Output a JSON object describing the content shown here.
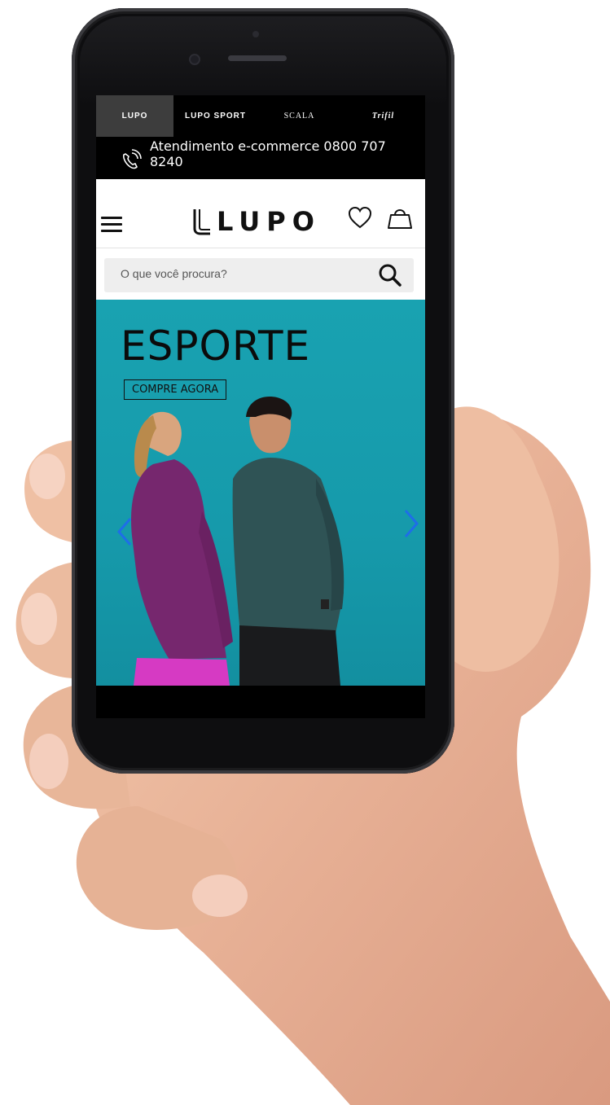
{
  "brand_tabs": [
    {
      "label": "LUPO",
      "active": true
    },
    {
      "label": "LUPO SPORT",
      "active": false
    },
    {
      "label": "SCALA",
      "active": false
    },
    {
      "label": "Trifil",
      "active": false
    }
  ],
  "support": {
    "text": "Atendimento e-commerce 0800 707 8240"
  },
  "header": {
    "logo": "LUPO",
    "icons": [
      "menu-icon",
      "heart-icon",
      "shopping-bag-icon"
    ]
  },
  "search": {
    "placeholder": "O que você procura?"
  },
  "banner": {
    "title": "ESPORTE",
    "cta": "COMPRE AGORA"
  },
  "colors": {
    "banner_bg": "#169aab",
    "topbar_bg": "#000000",
    "active_tab_bg": "#3d3d3d",
    "arrow": "#1e6ee8"
  }
}
